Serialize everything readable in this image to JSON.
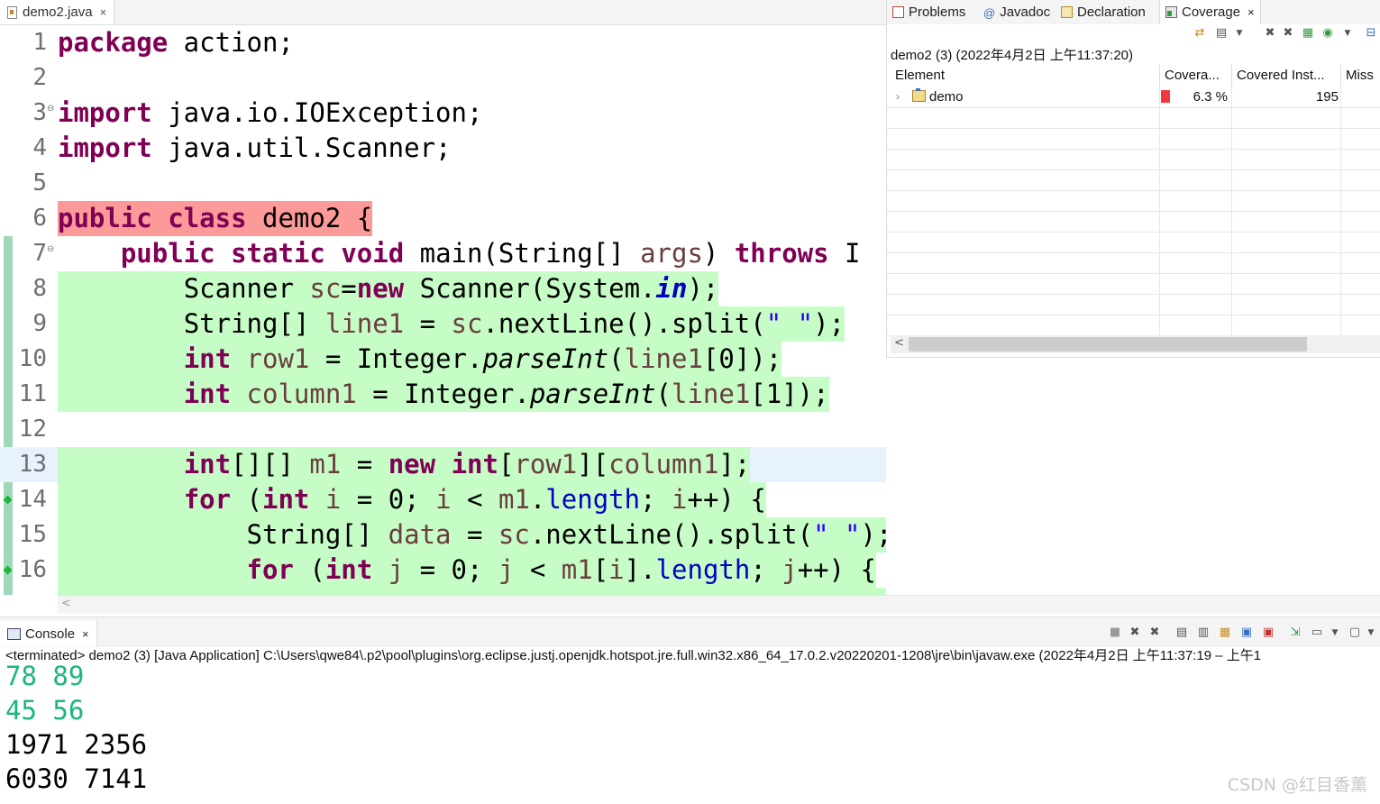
{
  "editor": {
    "tab": {
      "label": "demo2.java",
      "close": "×"
    },
    "lines": [
      {
        "num": "1",
        "fold": "",
        "marker": false,
        "hl": ""
      },
      {
        "num": "2",
        "fold": "",
        "marker": false,
        "hl": ""
      },
      {
        "num": "3",
        "fold": "⊖",
        "marker": false,
        "hl": ""
      },
      {
        "num": "4",
        "fold": "",
        "marker": false,
        "hl": ""
      },
      {
        "num": "5",
        "fold": "",
        "marker": false,
        "hl": ""
      },
      {
        "num": "6",
        "fold": "",
        "marker": false,
        "hl": "red"
      },
      {
        "num": "7",
        "fold": "⊖",
        "marker": false,
        "hl": ""
      },
      {
        "num": "8",
        "fold": "",
        "marker": false,
        "hl": "green"
      },
      {
        "num": "9",
        "fold": "",
        "marker": false,
        "hl": "green"
      },
      {
        "num": "10",
        "fold": "",
        "marker": false,
        "hl": "green"
      },
      {
        "num": "11",
        "fold": "",
        "marker": false,
        "hl": "green"
      },
      {
        "num": "12",
        "fold": "",
        "marker": false,
        "hl": ""
      },
      {
        "num": "13",
        "fold": "",
        "marker": false,
        "hl": "green"
      },
      {
        "num": "14",
        "fold": "",
        "marker": true,
        "hl": "green"
      },
      {
        "num": "15",
        "fold": "",
        "marker": false,
        "hl": "green"
      },
      {
        "num": "16",
        "fold": "",
        "marker": true,
        "hl": "green"
      }
    ],
    "code": {
      "l1_kw": "package",
      "l1_rest": " action;",
      "l3_kw": "import",
      "l3_rest": " java.io.IOException;",
      "l4_kw": "import",
      "l4_rest": " java.util.Scanner;",
      "l6_kw1": "public",
      "l6_kw2": "class",
      "l6_rest": " demo2 {",
      "l7_ind": "    ",
      "l7_kw1": "public",
      "l7_kw2": "static",
      "l7_kw3": "void",
      "l7_a": " main(String[] ",
      "l7_var": "args",
      "l7_b": ") ",
      "l7_kw4": "throws",
      "l7_c": " I",
      "l8_ind": "        ",
      "l8_a": "Scanner ",
      "l8_var": "sc",
      "l8_b": "=",
      "l8_kw": "new",
      "l8_c": " Scanner(System.",
      "l8_fld": "in",
      "l8_d": ");",
      "l9_ind": "        ",
      "l9_a": "String[] ",
      "l9_var": "line1",
      "l9_b": " = ",
      "l9_var2": "sc",
      "l9_c": ".nextLine().split(",
      "l9_str": "\" \"",
      "l9_d": ");",
      "l10_ind": "        ",
      "l10_kw": "int",
      "l10_a": " ",
      "l10_var": "row1",
      "l10_b": " = Integer.",
      "l10_it": "parseInt",
      "l10_c": "(",
      "l10_var2": "line1",
      "l10_d": "[0]);",
      "l11_ind": "        ",
      "l11_kw": "int",
      "l11_a": " ",
      "l11_var": "column1",
      "l11_b": " = Integer.",
      "l11_it": "parseInt",
      "l11_c": "(",
      "l11_var2": "line1",
      "l11_d": "[1]);",
      "l13_ind": "        ",
      "l13_kw": "int",
      "l13_a": "[][] ",
      "l13_var": "m1",
      "l13_b": " = ",
      "l13_kw2": "new",
      "l13_c": " ",
      "l13_kw3": "int",
      "l13_d": "[",
      "l13_var2": "row1",
      "l13_e": "][",
      "l13_var3": "column1",
      "l13_f": "];",
      "l14_ind": "        ",
      "l14_kw": "for",
      "l14_a": " (",
      "l14_kw2": "int",
      "l14_b": " ",
      "l14_var": "i",
      "l14_c": " = 0; ",
      "l14_var2": "i",
      "l14_d": " < ",
      "l14_var3": "m1",
      "l14_e": ".",
      "l14_fld": "length",
      "l14_f": "; ",
      "l14_var4": "i",
      "l14_g": "++) {",
      "l15_ind": "            ",
      "l15_a": "String[] ",
      "l15_var": "data",
      "l15_b": " = ",
      "l15_var2": "sc",
      "l15_c": ".nextLine().split(",
      "l15_str": "\" \"",
      "l15_d": ");",
      "l16_ind": "            ",
      "l16_kw": "for",
      "l16_a": " (",
      "l16_kw2": "int",
      "l16_b": " ",
      "l16_var": "j",
      "l16_c": " = 0; ",
      "l16_var2": "j",
      "l16_d": " < ",
      "l16_var3": "m1",
      "l16_e": "[",
      "l16_var4": "i",
      "l16_f": "].",
      "l16_fld": "length",
      "l16_g": "; ",
      "l16_var5": "j",
      "l16_h": "++) {"
    },
    "hscroll_arrow": "<"
  },
  "views": {
    "tabs": [
      {
        "label": "Problems",
        "icon": "problems-icon",
        "active": false
      },
      {
        "label": "Javadoc",
        "icon": "javadoc-icon",
        "active": false
      },
      {
        "label": "Declaration",
        "icon": "declaration-icon",
        "active": false
      },
      {
        "label": "Coverage",
        "icon": "coverage-icon",
        "active": true
      }
    ],
    "coverage": {
      "close": "×",
      "session": "demo2 (3) (2022年4月2日 上午11:37:20)",
      "columns": [
        "Element",
        "Covera...",
        "Covered Inst...",
        "Miss"
      ],
      "rows": [
        {
          "element": "demo",
          "coverage": "6.3 %",
          "covered": "195",
          "coverage_fraction": 0.063
        }
      ],
      "scroll_arrow": "<"
    }
  },
  "console": {
    "tab": "Console",
    "close": "×",
    "description": "<terminated> demo2 (3) [Java Application] C:\\Users\\qwe84\\.p2\\pool\\plugins\\org.eclipse.justj.openjdk.hotspot.jre.full.win32.x86_64_17.0.2.v20220201-1208\\jre\\bin\\javaw.exe  (2022年4月2日 上午11:37:19 – 上午1",
    "output": [
      {
        "text": "78 89",
        "kind": "input"
      },
      {
        "text": "45 56",
        "kind": "input"
      },
      {
        "text": "1971 2356",
        "kind": "output"
      },
      {
        "text": "6030 7141",
        "kind": "output"
      }
    ]
  },
  "watermark": "CSDN @红目香薰",
  "colors": {
    "covered": "#c6fcc6",
    "missed": "#fc9a9a",
    "keyword": "#7f0055",
    "local_var": "#6a3e3e",
    "field": "#0000c0",
    "console_input": "#1ab77a"
  }
}
